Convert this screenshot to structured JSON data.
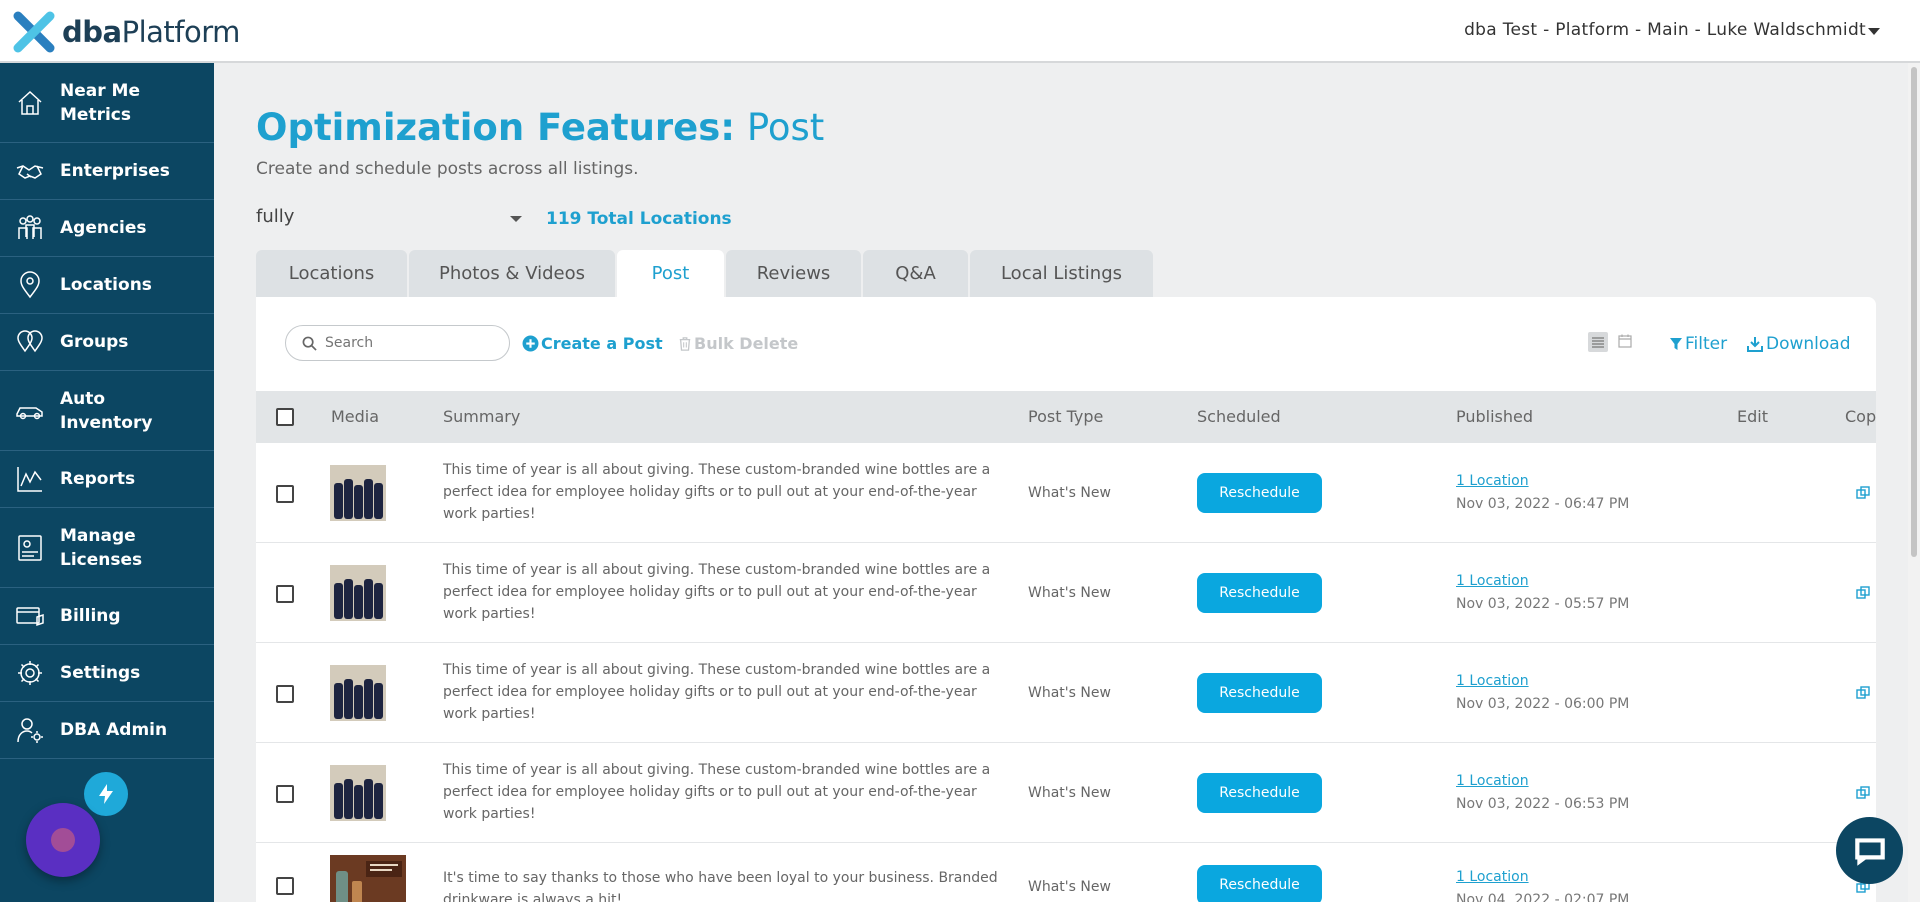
{
  "header": {
    "logo_bold": "dba",
    "logo_rest": "Platform",
    "account": "dba Test - Platform - Main - Luke Waldschmidt"
  },
  "sidebar": {
    "items": [
      {
        "label": "Near Me Metrics",
        "icon": "home-icon"
      },
      {
        "label": "Enterprises",
        "icon": "handshake-icon"
      },
      {
        "label": "Agencies",
        "icon": "people-icon"
      },
      {
        "label": "Locations",
        "icon": "map-pin-icon"
      },
      {
        "label": "Groups",
        "icon": "map-pins-icon"
      },
      {
        "label": "Auto Inventory",
        "icon": "car-icon"
      },
      {
        "label": "Reports",
        "icon": "line-chart-icon"
      },
      {
        "label": "Manage Licenses",
        "icon": "license-icon"
      },
      {
        "label": "Billing",
        "icon": "billing-icon"
      },
      {
        "label": "Settings",
        "icon": "gear-icon"
      },
      {
        "label": "DBA Admin",
        "icon": "admin-user-icon"
      }
    ]
  },
  "page": {
    "title_bold": "Optimization Features:",
    "title_rest": " Post",
    "subtitle": "Create and schedule posts across all listings.",
    "location_filter": "fully",
    "total_locations": "119 Total Locations"
  },
  "tabs": [
    {
      "label": "Locations",
      "active": false
    },
    {
      "label": "Photos & Videos",
      "active": false
    },
    {
      "label": "Post",
      "active": true
    },
    {
      "label": "Reviews",
      "active": false
    },
    {
      "label": "Q&A",
      "active": false
    },
    {
      "label": "Local Listings",
      "active": false
    }
  ],
  "toolbar": {
    "search_placeholder": "Search",
    "create_label": "Create a Post",
    "bulk_delete_label": "Bulk Delete",
    "filter_label": "Filter",
    "download_label": "Download"
  },
  "table": {
    "columns": [
      "Media",
      "Summary",
      "Post Type",
      "Scheduled",
      "Published",
      "Edit",
      "Cop"
    ],
    "rows": [
      {
        "summary": "This time of year is all about giving. These custom-branded wine bottles are a perfect idea for employee holiday gifts or to pull out at your end-of-the-year work parties!",
        "post_type": "What's New",
        "button": "Reschedule",
        "published_link": "1 Location",
        "published_date": "Nov 03, 2022 - 06:47 PM",
        "media": "wine"
      },
      {
        "summary": "This time of year is all about giving. These custom-branded wine bottles are a perfect idea for employee holiday gifts or to pull out at your end-of-the-year work parties!",
        "post_type": "What's New",
        "button": "Reschedule",
        "published_link": "1 Location",
        "published_date": "Nov 03, 2022 - 05:57 PM",
        "media": "wine"
      },
      {
        "summary": "This time of year is all about giving. These custom-branded wine bottles are a perfect idea for employee holiday gifts or to pull out at your end-of-the-year work parties!",
        "post_type": "What's New",
        "button": "Reschedule",
        "published_link": "1 Location",
        "published_date": "Nov 03, 2022 - 06:00 PM",
        "media": "wine"
      },
      {
        "summary": "This time of year is all about giving. These custom-branded wine bottles are a perfect idea for employee holiday gifts or to pull out at your end-of-the-year work parties!",
        "post_type": "What's New",
        "button": "Reschedule",
        "published_link": "1 Location",
        "published_date": "Nov 03, 2022 - 06:53 PM",
        "media": "wine"
      },
      {
        "summary": "It's time to say thanks to those who have been loyal to your business. Branded drinkware is always a hit!",
        "post_type": "What's New",
        "button": "Reschedule",
        "published_link": "1 Location",
        "published_date": "Nov 04, 2022 - 02:07 PM",
        "media": "drinkware"
      }
    ]
  },
  "colors": {
    "accent": "#1ea0cf",
    "sidebar": "#0c4662",
    "button": "#0aa7df"
  }
}
